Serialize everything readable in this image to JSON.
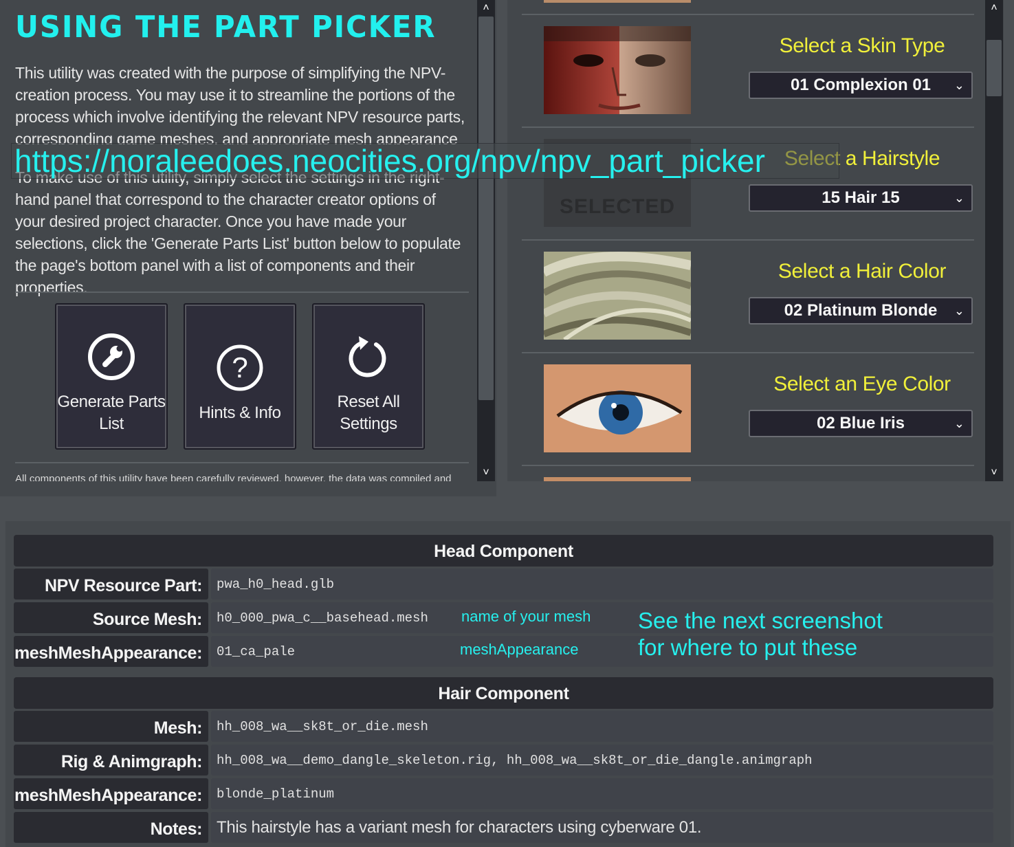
{
  "left_panel": {
    "title": "USING THE PART PICKER",
    "intro": "This utility was created with the purpose of simplifying the NPV-creation process. You may use it to streamline the portions of the process which involve identifying the relevant NPV resource parts, corresponding game meshes, and appropriate mesh appearance names.",
    "usage": "To make use of this utility, simply select the settings in the right-hand panel that correspond to the character creator options of your desired project character. Once you have made your selections, click the 'Generate Parts List' button below to populate the page's bottom panel with a list of components and their properties.",
    "buttons": {
      "generate": "Generate Parts List",
      "hints": "Hints & Info",
      "reset": "Reset All Settings"
    },
    "footnote": "All components of this utility have been carefully reviewed, however, the data was compiled and"
  },
  "url_overlay": "https://noraleedoes.neocities.org/npv/npv_part_picker",
  "right_panel": {
    "options": [
      {
        "label": "Select a Skin Type",
        "value": "01 Complexion 01",
        "image": "face-skin-preview"
      },
      {
        "label": "Select a Hairstyle",
        "value": "15 Hair 15",
        "image": "no-image-selected",
        "placeholder": "SELECTED"
      },
      {
        "label": "Select a Hair Color",
        "value": "02 Platinum Blonde",
        "image": "hair-color-preview"
      },
      {
        "label": "Select an Eye Color",
        "value": "02 Blue Iris",
        "image": "eye-color-preview"
      }
    ]
  },
  "bottom_panel": {
    "head": {
      "title": "Head Component",
      "rows": [
        {
          "key": "NPV Resource Part:",
          "value": "pwa_h0_head.glb"
        },
        {
          "key": "Source Mesh:",
          "value": "h0_000_pwa_c__basehead.mesh"
        },
        {
          "key": "meshMeshAppearance:",
          "value": "01_ca_pale"
        }
      ]
    },
    "hair": {
      "title": "Hair Component",
      "rows": [
        {
          "key": "Mesh:",
          "value": "hh_008_wa__sk8t_or_die.mesh"
        },
        {
          "key": "Rig & Animgraph:",
          "value": "hh_008_wa__demo_dangle_skeleton.rig, hh_008_wa__sk8t_or_die_dangle.animgraph"
        },
        {
          "key": "meshMeshAppearance:",
          "value": "blonde_platinum"
        },
        {
          "key": "Notes:",
          "value": "This hairstyle has a variant mesh for characters using cyberware 01."
        }
      ]
    },
    "annotations": {
      "mesh_name": "name of your mesh",
      "mesh_appearance": "meshAppearance",
      "note_line1": "See the next screenshot",
      "note_line2": "for where to put these"
    }
  },
  "colors": {
    "title_cyan": "#22f0ee",
    "label_yellow": "#f1f03a",
    "panel_bg": "#43474b",
    "button_bg": "#2e2d3a"
  }
}
